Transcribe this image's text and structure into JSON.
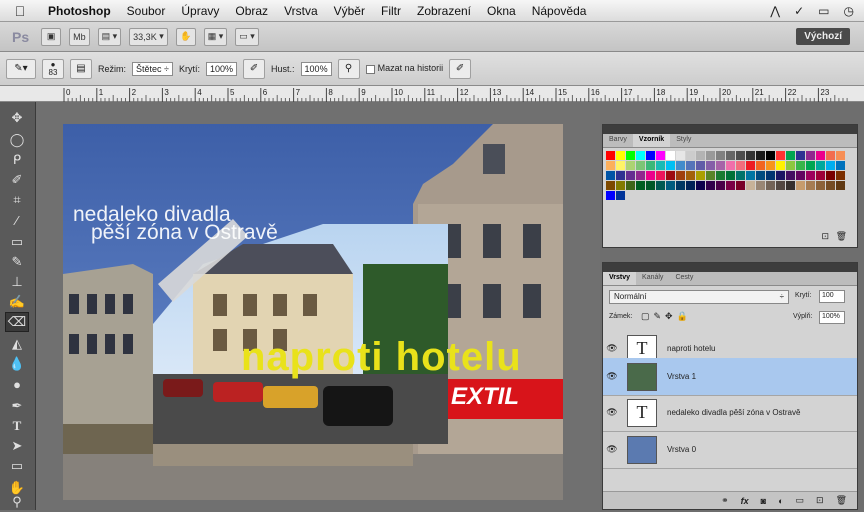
{
  "menubar": {
    "apple_icon": "apple-icon",
    "app": "Photoshop",
    "items": [
      "Soubor",
      "Úpravy",
      "Obraz",
      "Vrstva",
      "Výběr",
      "Filtr",
      "Zobrazení",
      "Okna",
      "Nápověda"
    ]
  },
  "appbar": {
    "logo": "Ps",
    "zoom": "33,3K",
    "workspace": "Výchozí"
  },
  "options": {
    "brush_size": "83",
    "mode_label": "Režim:",
    "mode_value": "Štětec",
    "opacity_label": "Krytí:",
    "opacity_value": "100%",
    "flow_label": "Hust.:",
    "flow_value": "100%",
    "erase_history_label": "Mazat na historii"
  },
  "ruler": {
    "ticks": [
      "0",
      "1",
      "2",
      "3",
      "4",
      "5",
      "6",
      "7",
      "8",
      "9",
      "10",
      "11",
      "12",
      "13",
      "14",
      "15",
      "16",
      "17",
      "18",
      "19",
      "20",
      "21",
      "22",
      "23"
    ]
  },
  "canvas": {
    "text_line1": "nedaleko divadla",
    "text_line2": "pěší zóna v Ostravě",
    "headline": "naproti hotelu",
    "sign": "EXTIL"
  },
  "swatches_panel": {
    "tabs": [
      "Barvy",
      "Vzorník",
      "Styly"
    ],
    "colors": [
      "#ff0000",
      "#ffff00",
      "#00ff00",
      "#00ffff",
      "#0000ff",
      "#ff00ff",
      "#ffffff",
      "#e6e6e6",
      "#cccccc",
      "#b3b3b3",
      "#999999",
      "#808080",
      "#666666",
      "#4d4d4d",
      "#333333",
      "#1a1a1a",
      "#000000",
      "#ff3333",
      "#00a651",
      "#2e3192",
      "#92278f",
      "#ec008c",
      "#f26c4f",
      "#f68e55",
      "#fbaf5c",
      "#fff467",
      "#acd372",
      "#7cc576",
      "#3bb878",
      "#1abbb4",
      "#00bff3",
      "#438ccb",
      "#5574b9",
      "#605ca8",
      "#855fa8",
      "#a763a8",
      "#f06eaa",
      "#f26d7d",
      "#ed1c24",
      "#f26522",
      "#f7941d",
      "#fff200",
      "#8dc73f",
      "#39b54a",
      "#00a651",
      "#00a99d",
      "#00aeef",
      "#0072bc",
      "#0054a6",
      "#2e3192",
      "#662d91",
      "#92278f",
      "#ec008c",
      "#ed145b",
      "#9e0b0f",
      "#a0410d",
      "#a36209",
      "#aba000",
      "#598527",
      "#1a7b30",
      "#007236",
      "#00746b",
      "#0076a3",
      "#004b80",
      "#003471",
      "#1b1464",
      "#440e62",
      "#630460",
      "#9e005d",
      "#9e0039",
      "#790000",
      "#7b2e00",
      "#7d4900",
      "#827b00",
      "#406618",
      "#005e20",
      "#005826",
      "#005952",
      "#005b7f",
      "#003663",
      "#002157",
      "#0d004c",
      "#32004b",
      "#4b0049",
      "#7b0046",
      "#7a0026",
      "#c7b299",
      "#998675",
      "#736357",
      "#534741",
      "#37302d",
      "#c69c6d",
      "#a67c52",
      "#8c6239",
      "#754c24",
      "#603913",
      "#0000ff",
      "#003399"
    ]
  },
  "layers_panel": {
    "tabs": [
      "Vrstvy",
      "Kanály",
      "Cesty"
    ],
    "blend_mode": "Normální",
    "opacity_label": "Krytí:",
    "opacity_value": "100",
    "lock_label": "Zámek:",
    "fill_label": "Výplň:",
    "fill_value": "100%",
    "layers": [
      {
        "name": "naproti hotelu",
        "kind": "T",
        "selected": false
      },
      {
        "name": "Vrstva 1",
        "kind": "img",
        "selected": true
      },
      {
        "name": "nedaleko divadla   pěší zóna v Ostravě",
        "kind": "T",
        "selected": false
      },
      {
        "name": "Vrstva 0",
        "kind": "img",
        "selected": false
      }
    ],
    "footer_icons": [
      "link-icon",
      "fx-icon",
      "mask-icon",
      "adjustment-icon",
      "folder-icon",
      "new-layer-icon",
      "trash-icon"
    ]
  },
  "colors": {
    "selected_layer": "#a9c8ee",
    "headline": "#e9e21a",
    "sign_red": "#d8141a"
  }
}
